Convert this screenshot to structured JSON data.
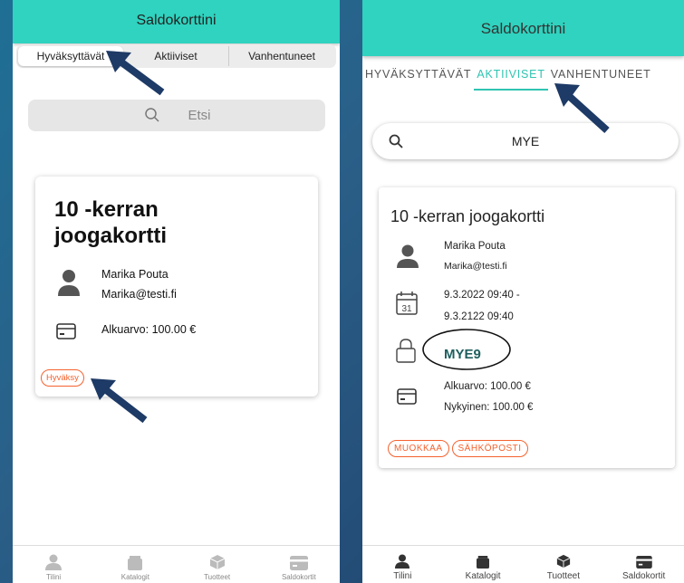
{
  "app": {
    "title": "Saldokorttini"
  },
  "left": {
    "tabs": [
      "Hyväksyttävät",
      "Aktiiviset",
      "Vanhentuneet"
    ],
    "search_placeholder": "Etsi",
    "card": {
      "title": "10 -kerran joogakortti",
      "name": "Marika Pouta",
      "email": "Marika@testi.fi",
      "amount": "Alkuarvo: 100.00 €",
      "action": "Hyväksy"
    }
  },
  "right": {
    "tabs": [
      "HYVÄKSYTTÄVÄT",
      "AKTIIVISET",
      "VANHENTUNEET"
    ],
    "search_value": "MYE",
    "card": {
      "title": "10 -kerran joogakortti",
      "name": "Marika Pouta",
      "email": "Marika@testi.fi",
      "date_start": "9.3.2022 09:40 -",
      "date_end": "9.3.2122 09:40",
      "calendar_day": "31",
      "code": "MYE9",
      "amount_start": "Alkuarvo: 100.00 €",
      "amount_current": "Nykyinen: 100.00 €",
      "actions": [
        "MUOKKAA",
        "SÄHKÖPOSTI"
      ]
    }
  },
  "nav": [
    "Tilini",
    "Katalogit",
    "Tuotteet",
    "Saldokortit"
  ],
  "colors": {
    "accent": "#2fd3bf",
    "chip": "#f4622e",
    "arrow": "#1e3a66"
  }
}
